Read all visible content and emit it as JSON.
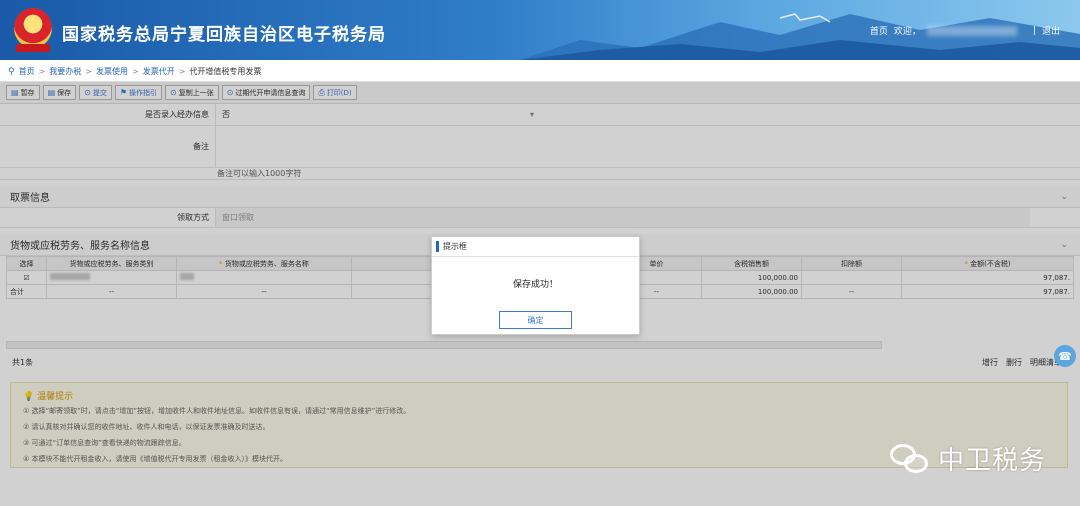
{
  "header": {
    "title": "国家税务总局宁夏回族自治区电子税务局",
    "home_link": "首页",
    "welcome": "欢迎，",
    "separator": "|",
    "logout": "退出"
  },
  "breadcrumb": {
    "items": [
      "首页",
      "我要办税",
      "发票使用",
      "发票代开"
    ],
    "current": "代开增值税专用发票"
  },
  "toolbar": {
    "buttons": [
      "暂存",
      "保存",
      "提交",
      "操作指引",
      "复制上一张",
      "过期代开申请信息查询",
      "打印(D)"
    ]
  },
  "form": {
    "field_pickup_label": "是否录入经办信息",
    "field_pickup_value": "否",
    "remark_label": "备注",
    "remark_hint": "备注可以输入1000字符"
  },
  "sections": {
    "ticket_info": "取票信息",
    "pickup_method_label": "领取方式",
    "pickup_method_value": "窗口领取",
    "goods_info": "货物或应税劳务、服务名称信息"
  },
  "table": {
    "headers": [
      "选择",
      "货物或应税劳务、服务类别",
      "货物或应税劳务、服务名称",
      "单价",
      "含税销售额",
      "扣除额",
      "金额(不含税)"
    ],
    "row1": {
      "select": "☑",
      "price": "",
      "sales": "100,000.00",
      "deduct": "",
      "amount": "97,087."
    },
    "total_row": {
      "label": "合计",
      "dash1": "--",
      "dash2": "--",
      "dash3": "--",
      "sales": "100,000.00",
      "deduct": "--",
      "amount": "97,087."
    }
  },
  "footer": {
    "count": "共1条",
    "add_row": "增行",
    "delete_row": "删行",
    "list": "明细清单"
  },
  "tips": {
    "title": "温馨提示",
    "lines": [
      "① 选择“邮寄领取”时，请点击“增加”按钮，增加收件人和收件地址信息。如收件信息有误，请通过“常用信息维护”进行修改。",
      "② 请认真核对并确认您的收件地址、收件人和电话，以保证发票准确及时送达。",
      "③ 可通过“订单信息查询”查看快递的物流跟踪信息。",
      "④ 本模块不能代开租金收入，请使用《增值税代开专用发票（租金收入）》模块代开。"
    ]
  },
  "dialog": {
    "title": "提示框",
    "message": "保存成功！",
    "confirm": "确定"
  },
  "watermark": {
    "text": "中卫税务"
  }
}
